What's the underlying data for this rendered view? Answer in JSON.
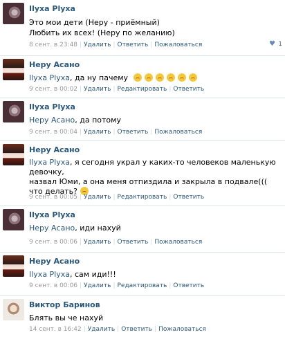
{
  "comments": [
    {
      "author": "Ilyxa Plyxa",
      "avatar": "ilyxa",
      "line1": "Это мои дети (Неру - приёмный)",
      "line2": "Любить их всех! (Неру по желанию)",
      "time": "8 сент. в 23:48",
      "actions": [
        "Удалить",
        "Ответить",
        "Пожаловаться"
      ],
      "likes": "1"
    },
    {
      "author": "Неру Асано",
      "avatar": "nery",
      "reply_to": "Ilyxa Plyxa",
      "text": ", да ну пачему",
      "emoji_count": 6,
      "time": "9 сент. в 00:02",
      "actions": [
        "Удалить",
        "Редактировать",
        "Ответить"
      ]
    },
    {
      "author": "Ilyxa Plyxa",
      "avatar": "ilyxa",
      "reply_to": "Неру Асано",
      "text": ", да потому",
      "time": "9 сент. в 00:04",
      "actions": [
        "Удалить",
        "Ответить",
        "Пожаловаться"
      ]
    },
    {
      "author": "Неру Асано",
      "avatar": "nery",
      "reply_to": "Ilyxa Plyxa",
      "line1": ", я сегодня украл у каких-то человеков маленькую девочку,",
      "line2": "назвал Юми, а она меня отпиздила и закрыла в подвале(((",
      "line3": "что делать?",
      "time": "9 сент. в 00:05",
      "actions": [
        "Удалить",
        "Редактировать",
        "Ответить"
      ]
    },
    {
      "author": "Ilyxa Plyxa",
      "avatar": "ilyxa",
      "reply_to": "Неру Асано",
      "text": ", иди нахуй",
      "time": "9 сент. в 00:06",
      "actions": [
        "Удалить",
        "Ответить",
        "Пожаловаться"
      ]
    },
    {
      "author": "Неру Асано",
      "avatar": "nery",
      "reply_to": "Ilyxa Plyxa",
      "text": ", сам иди!!!",
      "time": "9 сент. в 00:06",
      "actions": [
        "Удалить",
        "Редактировать",
        "Ответить"
      ]
    },
    {
      "author": "Виктор Баринов",
      "avatar": "viktor",
      "text": "Блять вы че нахуй",
      "time": "14 сент. в 16:42",
      "actions": [
        "Удалить",
        "Ответить",
        "Пожаловаться"
      ]
    }
  ]
}
